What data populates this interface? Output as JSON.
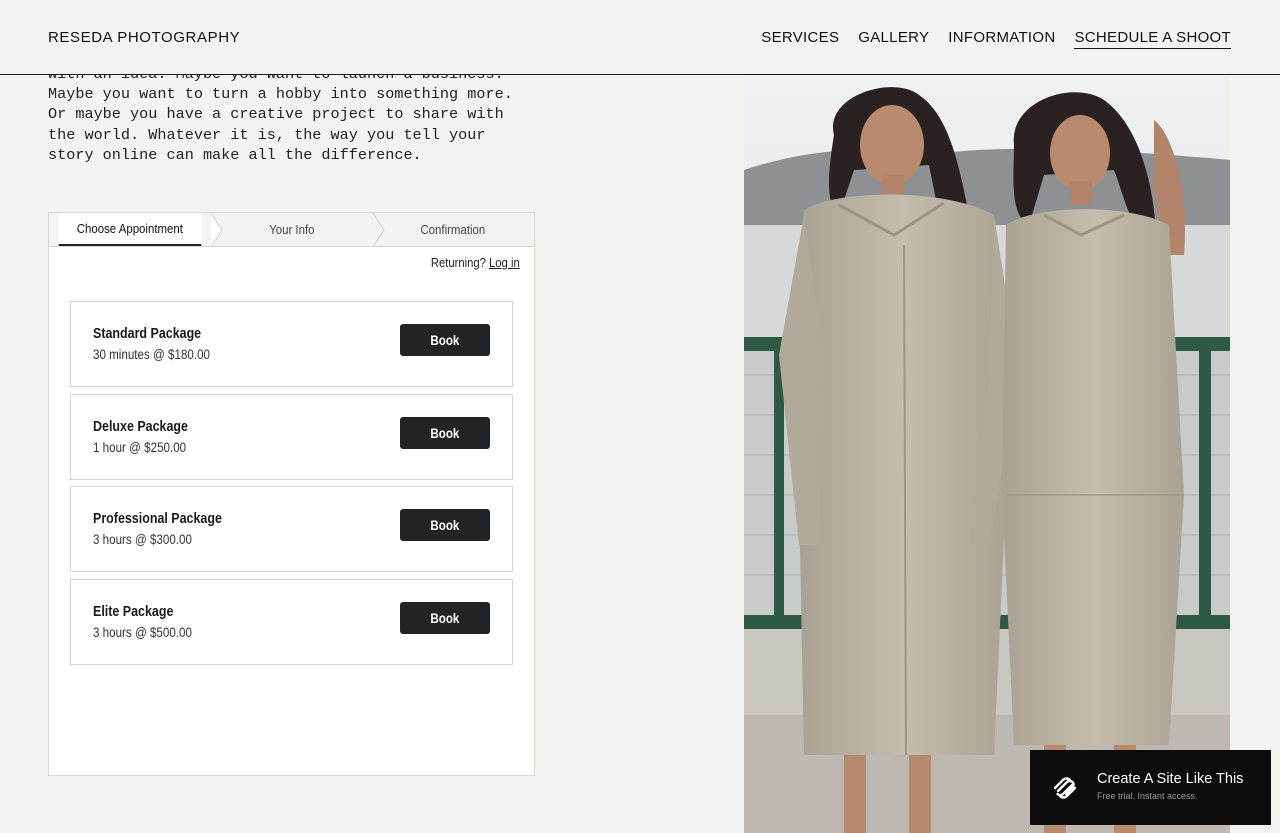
{
  "header": {
    "brand": "RESEDA PHOTOGRAPHY",
    "nav": [
      {
        "label": "SERVICES"
      },
      {
        "label": "GALLERY"
      },
      {
        "label": "INFORMATION"
      },
      {
        "label": "SCHEDULE A SHOOT",
        "active": true
      }
    ]
  },
  "intro": {
    "lines": [
      "with an idea. Maybe you want to launch a business.",
      "Maybe you want to turn a hobby into something more.",
      "Or maybe you have a creative project to share with",
      "the world. Whatever it is, the way you tell your",
      "story online can make all the difference."
    ]
  },
  "scheduler": {
    "steps": [
      {
        "label": "Choose Appointment",
        "active": true
      },
      {
        "label": "Your Info",
        "active": false
      },
      {
        "label": "Confirmation",
        "active": false
      }
    ],
    "returning_label": "Returning?",
    "login_label": "Log in",
    "packages": [
      {
        "name": "Standard Package",
        "desc": "30 minutes @ $180.00",
        "button": "Book"
      },
      {
        "name": "Deluxe Package",
        "desc": "1 hour @ $250.00",
        "button": "Book"
      },
      {
        "name": "Professional Package",
        "desc": "3 hours @ $300.00",
        "button": "Book"
      },
      {
        "name": "Elite Package",
        "desc": "3 hours @ $500.00",
        "button": "Book"
      }
    ]
  },
  "promo": {
    "title": "Create A Site Like This",
    "subtitle": "Free trial. Instant access.",
    "icon": "squarespace-logo-icon"
  },
  "colors": {
    "page_bg": "#f3f3ef",
    "button_bg": "#222326",
    "promo_bg": "#0c0c0c",
    "coat_color": "#bdb6a6",
    "railing_green": "#2e5a45"
  }
}
